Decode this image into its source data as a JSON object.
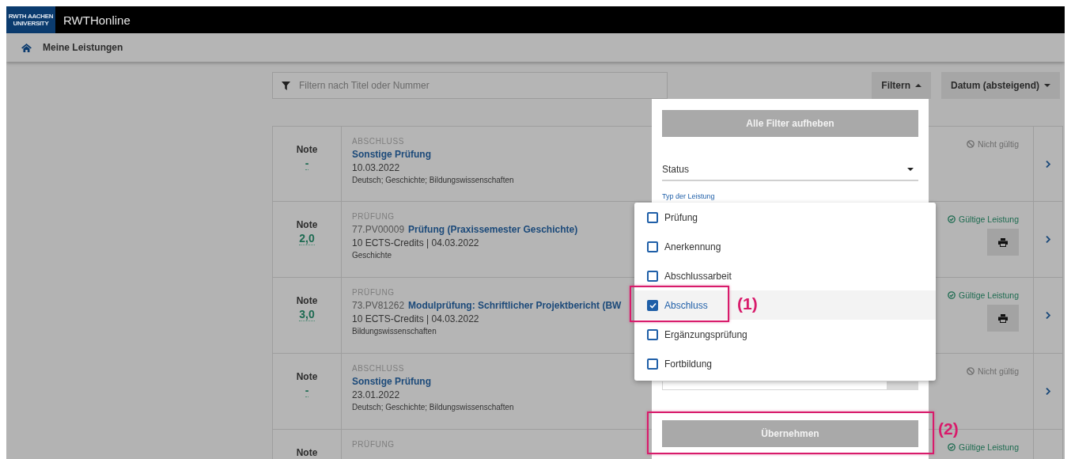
{
  "header": {
    "logo_line1": "RWTH AACHEN",
    "logo_line2": "UNIVERSITY",
    "app_name": "RWTHonline"
  },
  "breadcrumb": {
    "title": "Meine Leistungen"
  },
  "toolbar": {
    "search": {
      "placeholder": "Filtern nach Titel oder Nummer"
    },
    "filter_button": {
      "label": "Filtern",
      "expanded": true
    },
    "sort_button": {
      "label": "Datum (absteigend)"
    }
  },
  "records": [
    {
      "grade_label": "Note",
      "grade": "-",
      "category": "ABSCHLUSS",
      "title": "Sonstige Prüfung",
      "meta": "10.03.2022",
      "subjects": "Deutsch; Geschichte; Bildungswissenschaften",
      "status": {
        "kind": "invalid",
        "text": "Nicht gültig"
      },
      "printable": false
    },
    {
      "grade_label": "Note",
      "grade": "2,0",
      "category": "PRÜFUNG",
      "number": "77.PV00009",
      "title": "Prüfung (Praxissemester Geschichte)",
      "meta": "10 ECTS-Credits | 04.03.2022",
      "subjects": "Geschichte",
      "status": {
        "kind": "valid",
        "text": "Gültige Leistung"
      },
      "printable": true
    },
    {
      "grade_label": "Note",
      "grade": "3,0",
      "category": "PRÜFUNG",
      "number": "73.PV81262",
      "title": "Modulprüfung: Schriftlicher Projektbericht (BW",
      "meta": "10 ECTS-Credits | 04.03.2022",
      "subjects": "Bildungswissenschaften",
      "status": {
        "kind": "valid",
        "text": "Gültige Leistung"
      },
      "printable": true
    },
    {
      "grade_label": "Note",
      "grade": "-",
      "category": "ABSCHLUSS",
      "title": "Sonstige Prüfung",
      "meta": "23.01.2022",
      "subjects": "Deutsch; Geschichte; Bildungswissenschaften",
      "status": {
        "kind": "invalid",
        "text": "Nicht gültig"
      },
      "printable": false
    },
    {
      "grade_label": "Note",
      "category": "PRÜFUNG",
      "status": {
        "kind": "valid",
        "text": "Gültige Leistung"
      },
      "printable": false
    }
  ],
  "filter_panel": {
    "clear_button": "Alle Filter aufheben",
    "status_select": "Status",
    "type_label": "Typ der Leistung",
    "apply_button": "Übernehmen"
  },
  "type_options": [
    {
      "label": "Prüfung",
      "checked": false,
      "selected": false
    },
    {
      "label": "Anerkennung",
      "checked": false,
      "selected": false
    },
    {
      "label": "Abschlussarbeit",
      "checked": false,
      "selected": false
    },
    {
      "label": "Abschluss",
      "checked": true,
      "selected": true
    },
    {
      "label": "Ergänzungsprüfung",
      "checked": false,
      "selected": false
    },
    {
      "label": "Fortbildung",
      "checked": false,
      "selected": false
    }
  ],
  "annotations": [
    {
      "label": "(1)"
    },
    {
      "label": "(2)"
    }
  ]
}
